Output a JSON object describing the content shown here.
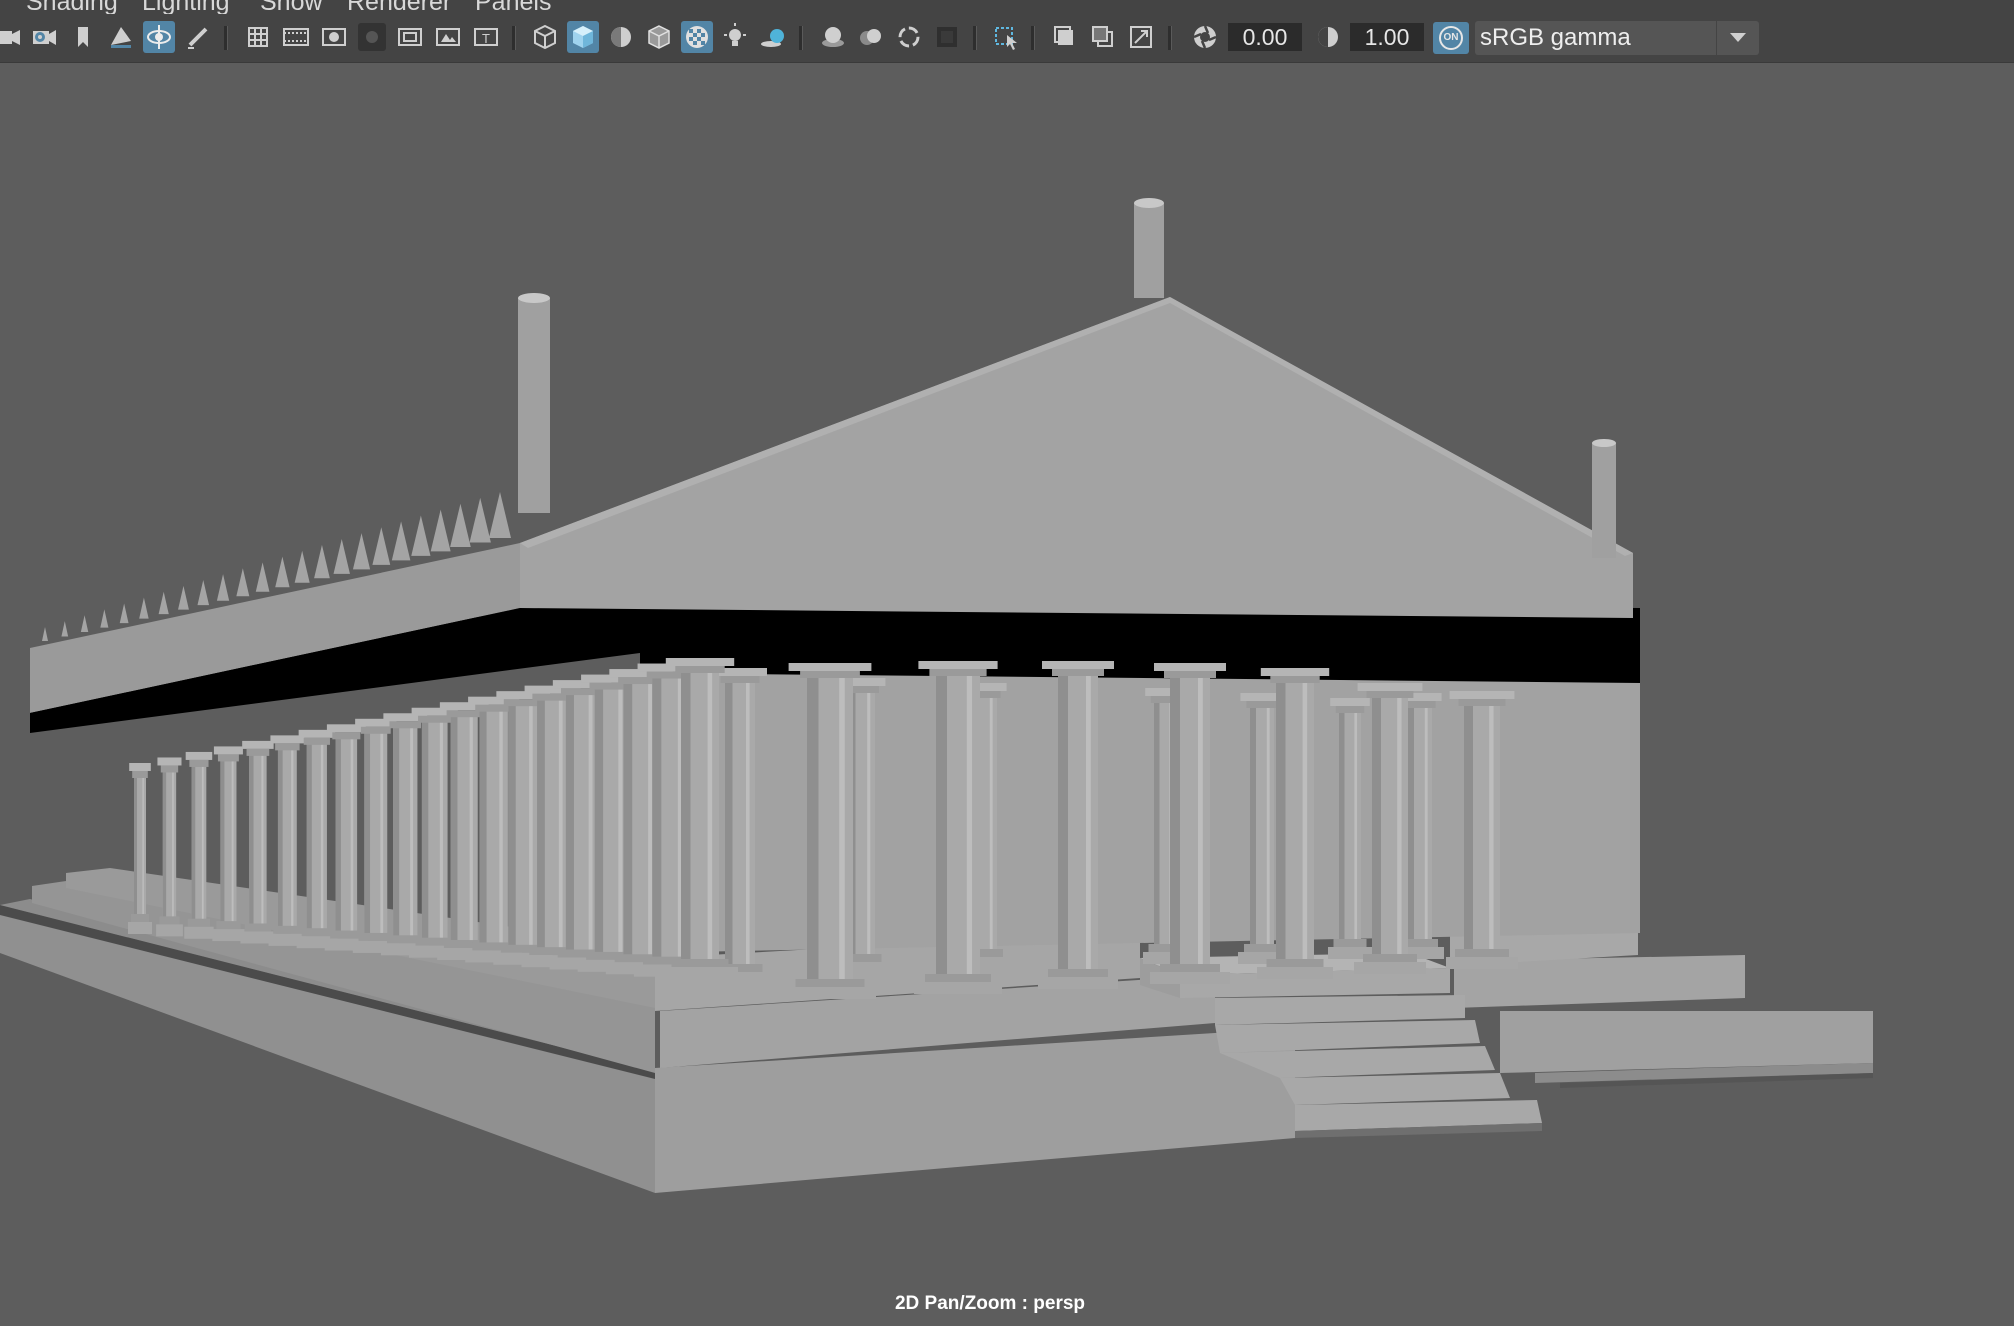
{
  "menu": {
    "items": [
      {
        "label": "Shading"
      },
      {
        "label": "Lighting"
      },
      {
        "label": "Show"
      },
      {
        "label": "Renderer"
      },
      {
        "label": "Panels"
      }
    ]
  },
  "toolbar": {
    "exposure_value": "0.00",
    "gamma_value": "1.00",
    "color_management_badge": "ON",
    "color_space": "sRGB gamma",
    "accent_color": "#5285a6",
    "icons": [
      "select-camera-icon",
      "camera-attributes-icon",
      "bookmark-icon",
      "image-plane-icon",
      "tumble-tool-icon",
      "grease-pencil-icon",
      "grid-icon",
      "film-gate-icon",
      "resolution-gate-icon",
      "gate-mask-icon",
      "field-chart-icon",
      "safe-action-icon",
      "safe-title-icon",
      "wireframe-icon",
      "smooth-shade-all-icon",
      "use-default-material-icon",
      "wireframe-on-shaded-icon",
      "xray-icon",
      "use-all-lights-icon",
      "shadows-icon",
      "screen-space-ao-icon",
      "motion-blur-icon",
      "multisample-aa-icon",
      "depth-of-field-icon",
      "isolate-select-icon",
      "xray-joints-icon",
      "xray-active-components-icon",
      "backface-culling-icon",
      "exposure-icon",
      "gamma-icon",
      "color-management-icon",
      "dropdown-arrow-icon"
    ]
  },
  "viewport": {
    "camera_label": "2D Pan/Zoom : persp",
    "background_color": "#5d5d5d"
  }
}
